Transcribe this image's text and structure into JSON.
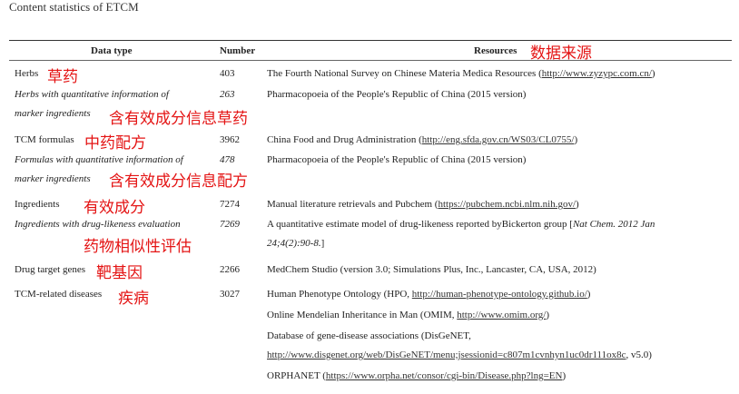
{
  "caption": "Content statistics of ETCM",
  "headers": {
    "data_type": "Data type",
    "number": "Number",
    "resources": "Resources",
    "resources_cn": "数据来源"
  },
  "rows": [
    {
      "type": "Herbs",
      "cn": "草药",
      "number": "403",
      "res_pre": "The Fourth National Survey on Chinese Materia Medica Resources (",
      "res_link": "http://www.zyzypc.com.cn/",
      "res_post": ")"
    },
    {
      "type_l1": "Herbs with quantitative information of",
      "type_l2": "marker ingredients",
      "cn": "含有效成分信息草药",
      "number": "263",
      "res": "Pharmacopoeia of the People's Republic of China (2015 version)"
    },
    {
      "type": "TCM formulas",
      "cn": "中药配方",
      "number": "3962",
      "res_pre": "China Food and Drug Administration (",
      "res_link": "http://eng.sfda.gov.cn/WS03/CL0755/",
      "res_post": ")"
    },
    {
      "type_l1": "Formulas with quantitative information of",
      "type_l2": "marker ingredients",
      "cn": "含有效成分信息配方",
      "number": "478",
      "res": "Pharmacopoeia of the People's Republic of China (2015 version)"
    },
    {
      "type": "Ingredients",
      "cn": "有效成分",
      "number": "7274",
      "res_pre": "Manual literature retrievals and Pubchem (",
      "res_link": "https://pubchem.ncbi.nlm.nih.gov/",
      "res_post": ")"
    },
    {
      "type": "Ingredients with drug-likeness evaluation",
      "cn": "药物相似性评估",
      "number": "7269",
      "res_l1_pre": "A quantitative estimate model of drug-likeness reported byBickerton group [",
      "res_l1_it": "Nat Chem. 2012 Jan",
      "res_l2_it": "24;4(2):90-8.",
      "res_l2_post": "]"
    },
    {
      "type": "Drug target genes",
      "cn": "靶基因",
      "number": "2266",
      "res": "MedChem Studio (version 3.0; Simulations Plus, Inc., Lancaster, CA, USA, 2012)"
    },
    {
      "type": "TCM-related diseases",
      "cn": "疾病",
      "number": "3027",
      "res1_pre": "Human Phenotype Ontology (HPO, ",
      "res1_link": "http://human-phenotype-ontology.github.io/",
      "res1_post": ")",
      "res2_pre": "Online Mendelian Inheritance in Man (OMIM, ",
      "res2_link": "http://www.omim.org/",
      "res2_post": ")",
      "res3_l1": "Database of gene-disease associations (DisGeNET,",
      "res3_link": "http://www.disgenet.org/web/DisGeNET/menu;jsessionid=c807m1cvnhyn1uc0dr111ox8c",
      "res3_post": ", v5.0)",
      "res4_pre": "ORPHANET (",
      "res4_link": "https://www.orpha.net/consor/cgi-bin/Disease.php?lng=EN",
      "res4_post": ")"
    }
  ],
  "colors": {
    "annotation": "#e41414",
    "text": "#222222"
  }
}
